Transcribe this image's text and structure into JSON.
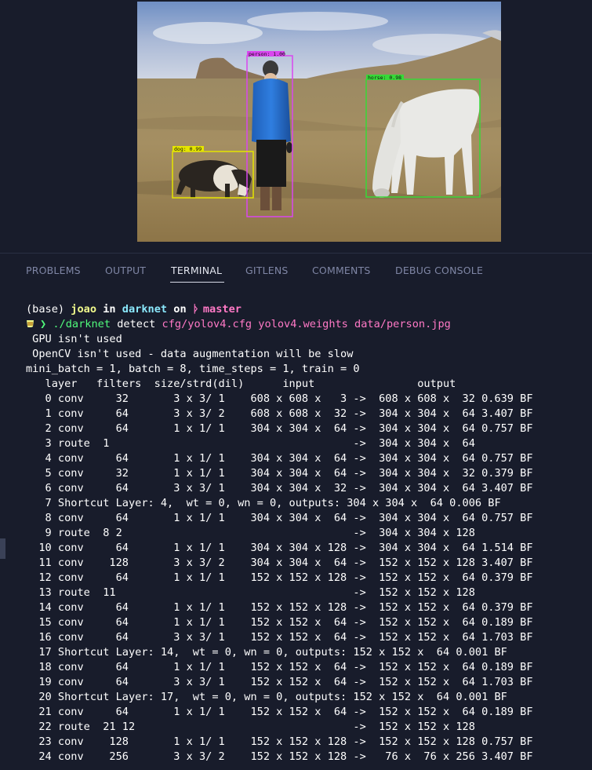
{
  "detections": [
    {
      "label": "person: 1.00",
      "color": "#d946ef"
    },
    {
      "label": "dog: 0.99",
      "color": "#e5e500"
    },
    {
      "label": "horse: 0.98",
      "color": "#38d838"
    }
  ],
  "panel_tabs": [
    {
      "label": "PROBLEMS",
      "active": false
    },
    {
      "label": "OUTPUT",
      "active": false
    },
    {
      "label": "TERMINAL",
      "active": true
    },
    {
      "label": "GITLENS",
      "active": false
    },
    {
      "label": "COMMENTS",
      "active": false
    },
    {
      "label": "DEBUG CONSOLE",
      "active": false
    }
  ],
  "prompt": {
    "env": "(base)",
    "user": "joao",
    "in": "in",
    "dir": "darknet",
    "on": "on",
    "branch": "master",
    "arrow": "❯",
    "cmd_exec": "./darknet",
    "cmd_sub": "detect",
    "cmd_args": "cfg/yolov4.cfg yolov4.weights data/person.jpg"
  },
  "output_lines": [
    " GPU isn't used",
    " OpenCV isn't used - data augmentation will be slow",
    "mini_batch = 1, batch = 8, time_steps = 1, train = 0",
    "   layer   filters  size/strd(dil)      input                output",
    "   0 conv     32       3 x 3/ 1    608 x 608 x   3 ->  608 x 608 x  32 0.639 BF",
    "   1 conv     64       3 x 3/ 2    608 x 608 x  32 ->  304 x 304 x  64 3.407 BF",
    "   2 conv     64       1 x 1/ 1    304 x 304 x  64 ->  304 x 304 x  64 0.757 BF",
    "   3 route  1                                      ->  304 x 304 x  64",
    "   4 conv     64       1 x 1/ 1    304 x 304 x  64 ->  304 x 304 x  64 0.757 BF",
    "   5 conv     32       1 x 1/ 1    304 x 304 x  64 ->  304 x 304 x  32 0.379 BF",
    "   6 conv     64       3 x 3/ 1    304 x 304 x  32 ->  304 x 304 x  64 3.407 BF",
    "   7 Shortcut Layer: 4,  wt = 0, wn = 0, outputs: 304 x 304 x  64 0.006 BF",
    "   8 conv     64       1 x 1/ 1    304 x 304 x  64 ->  304 x 304 x  64 0.757 BF",
    "   9 route  8 2                                    ->  304 x 304 x 128",
    "  10 conv     64       1 x 1/ 1    304 x 304 x 128 ->  304 x 304 x  64 1.514 BF",
    "  11 conv    128       3 x 3/ 2    304 x 304 x  64 ->  152 x 152 x 128 3.407 BF",
    "  12 conv     64       1 x 1/ 1    152 x 152 x 128 ->  152 x 152 x  64 0.379 BF",
    "  13 route  11                                     ->  152 x 152 x 128",
    "  14 conv     64       1 x 1/ 1    152 x 152 x 128 ->  152 x 152 x  64 0.379 BF",
    "  15 conv     64       1 x 1/ 1    152 x 152 x  64 ->  152 x 152 x  64 0.189 BF",
    "  16 conv     64       3 x 3/ 1    152 x 152 x  64 ->  152 x 152 x  64 1.703 BF",
    "  17 Shortcut Layer: 14,  wt = 0, wn = 0, outputs: 152 x 152 x  64 0.001 BF",
    "  18 conv     64       1 x 1/ 1    152 x 152 x  64 ->  152 x 152 x  64 0.189 BF",
    "  19 conv     64       3 x 3/ 1    152 x 152 x  64 ->  152 x 152 x  64 1.703 BF",
    "  20 Shortcut Layer: 17,  wt = 0, wn = 0, outputs: 152 x 152 x  64 0.001 BF",
    "  21 conv     64       1 x 1/ 1    152 x 152 x  64 ->  152 x 152 x  64 0.189 BF",
    "  22 route  21 12                                  ->  152 x 152 x 128",
    "  23 conv    128       1 x 1/ 1    152 x 152 x 128 ->  152 x 152 x 128 0.757 BF",
    "  24 conv    256       3 x 3/ 2    152 x 152 x 128 ->   76 x  76 x 256 3.407 BF"
  ]
}
